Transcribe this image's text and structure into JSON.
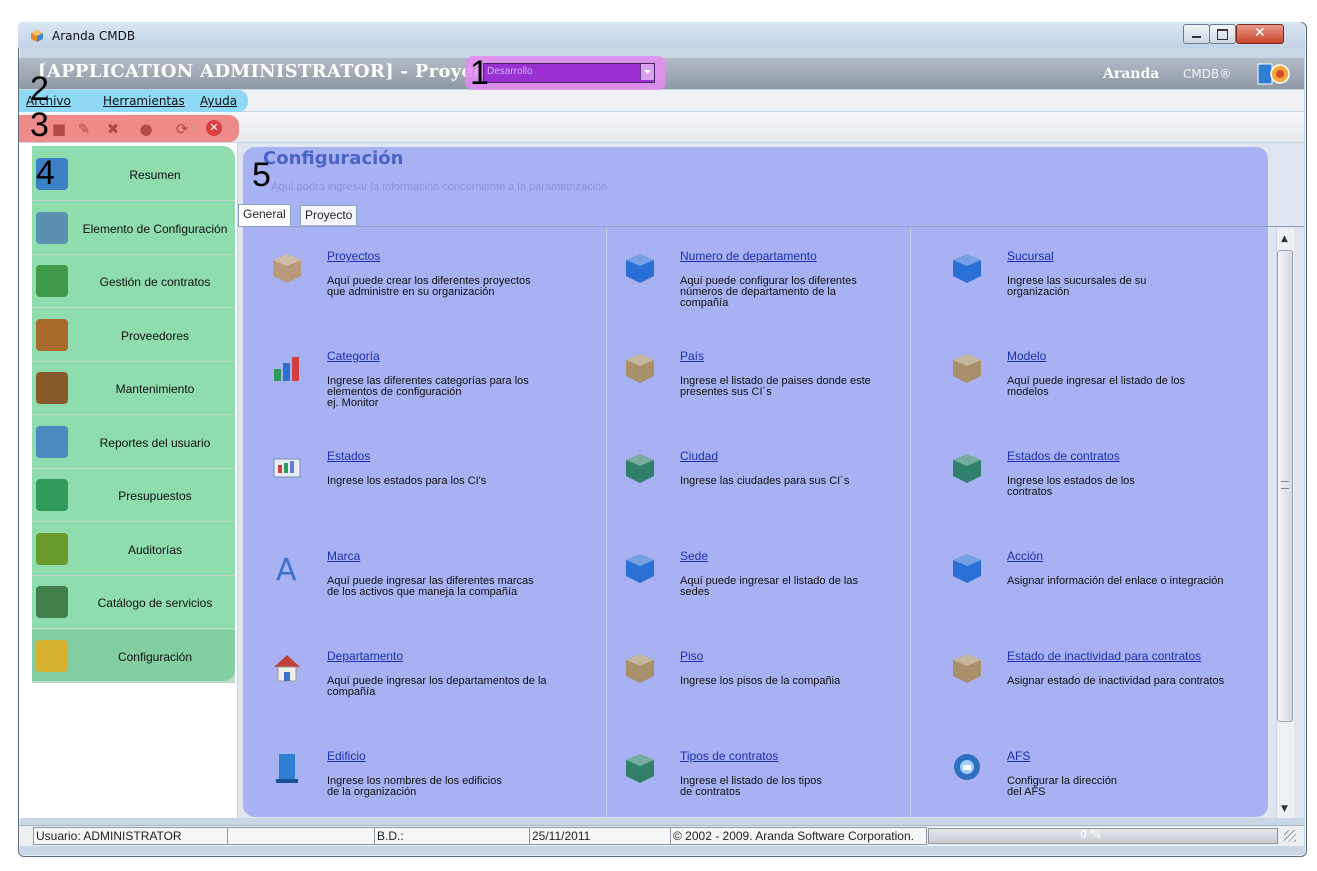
{
  "window": {
    "title": "Aranda CMDB"
  },
  "header": {
    "app_title": "[APPLICATION ADMINISTRATOR] - Proyecto",
    "brand": "Aranda",
    "brand_sub": "CMDB®"
  },
  "project_select": {
    "value": "Desarrollo"
  },
  "annotations": [
    "1",
    "2",
    "3",
    "4",
    "5"
  ],
  "menu": [
    {
      "label": "Archivo"
    },
    {
      "label": "Herramientas"
    },
    {
      "label": "Ayuda"
    }
  ],
  "toolbar": {
    "icons": [
      "new-icon",
      "edit-icon",
      "delete-icon",
      "stop-icon",
      "refresh-icon",
      "close-icon"
    ]
  },
  "sidebar": {
    "items": [
      {
        "label": "Resumen",
        "icon": "resumen-icon"
      },
      {
        "label": "Elemento de Configuración",
        "icon": "server-icon"
      },
      {
        "label": "Gestión de contratos",
        "icon": "contract-icon"
      },
      {
        "label": "Proveedores",
        "icon": "users-icon"
      },
      {
        "label": "Mantenimiento",
        "icon": "briefcase-icon"
      },
      {
        "label": "Reportes del usuario",
        "icon": "reports-icon"
      },
      {
        "label": "Presupuestos",
        "icon": "money-icon"
      },
      {
        "label": "Auditorías",
        "icon": "audit-icon"
      },
      {
        "label": "Catálogo de servicios",
        "icon": "gears-icon"
      },
      {
        "label": "Configuración",
        "icon": "config-gear-icon"
      }
    ]
  },
  "content": {
    "title": "Configuración",
    "subtitle": "Aquí podrá ingresar la información concerniente a la parametrización",
    "tabs": [
      {
        "label": "General"
      },
      {
        "label": "Proyecto"
      }
    ],
    "items": [
      {
        "title": "Proyectos",
        "desc": [
          "Aquí puede crear los diferentes proyectos",
          "que administre en su organización"
        ],
        "icon": "box-icon"
      },
      {
        "title": "Numero de departamento",
        "desc": [
          "Aquí puede configurar los diferentes",
          "números de departamento de la",
          "compañía"
        ],
        "icon": "cube-blue-icon"
      },
      {
        "title": "Sucursal",
        "desc": [
          "Ingrese las sucursales de su",
          "organización"
        ],
        "icon": "cube-blue-icon"
      },
      {
        "title": "Categoría",
        "desc": [
          "Ingrese las diferentes categorías para los",
          "elementos de configuración",
          "ej. Monitor"
        ],
        "icon": "bars-icon"
      },
      {
        "title": "País",
        "desc": [
          "Ingrese el listado de paises donde este",
          "presentes sus CI´s"
        ],
        "icon": "cube-tan-icon"
      },
      {
        "title": "Modelo",
        "desc": [
          "Aquí puede ingresar el listado de los",
          "modelos"
        ],
        "icon": "cube-tan-icon"
      },
      {
        "title": "Estados",
        "desc": [
          "Ingrese los estados para los CI's"
        ],
        "icon": "chart-icon"
      },
      {
        "title": "Ciudad",
        "desc": [
          "Ingrese las ciudades para sus CI´s"
        ],
        "icon": "cube-green-icon"
      },
      {
        "title": "Estados de contratos",
        "desc": [
          "Ingrese los estados de los",
          "contratos"
        ],
        "icon": "cube-green-icon"
      },
      {
        "title": "Marca",
        "desc": [
          "Aquí puede ingresar las diferentes marcas",
          "de los activos que maneja la compañía"
        ],
        "icon": "letter-a-icon"
      },
      {
        "title": "Sede",
        "desc": [
          "Aquí puede ingresar el listado de las",
          "sedes"
        ],
        "icon": "cube-blue-icon"
      },
      {
        "title": "Acción",
        "desc": [
          "Asignar información del enlace o integración"
        ],
        "icon": "cube-blue-icon"
      },
      {
        "title": "Departamento",
        "desc": [
          "Aquí puede ingresar los departamentos de la",
          "compañía"
        ],
        "icon": "house-icon"
      },
      {
        "title": "Piso",
        "desc": [
          "Ingrese los pisos de la compañia"
        ],
        "icon": "cube-tan-icon"
      },
      {
        "title": "Estado de inactividad para contratos",
        "desc": [
          "Asignar estado de inactividad para contratos"
        ],
        "icon": "cube-tan-icon"
      },
      {
        "title": "Edificio",
        "desc": [
          "Ingrese los nombres de los edificios",
          "de la organización"
        ],
        "icon": "building-icon"
      },
      {
        "title": "Tipos de contratos",
        "desc": [
          "Ingrese el listado de los tipos",
          "de contratos"
        ],
        "icon": "cube-green-icon"
      },
      {
        "title": "AFS",
        "desc": [
          "Configurar la dirección",
          "del AFS"
        ],
        "icon": "afs-icon"
      }
    ]
  },
  "status": {
    "user": "Usuario: ADMINISTRATOR",
    "blank": "",
    "db": "B.D.:",
    "date": "25/11/2011",
    "copyright": "© 2002 - 2009. Aranda Software Corporation.",
    "progress_text": "0 %",
    "progress": 0
  },
  "colors": {
    "annotation_1": "#e58bf2",
    "annotation_2": "#8fd9f5",
    "annotation_3": "#ee8a8a",
    "annotation_4": "#8fdcae",
    "annotation_5": "#a8b2f2",
    "link": "#1a2fb2"
  }
}
